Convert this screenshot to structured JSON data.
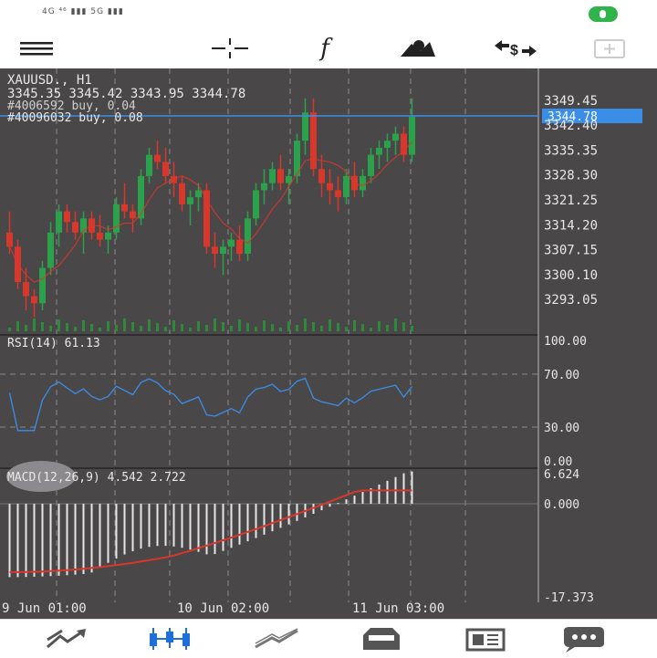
{
  "status": {
    "left_text": "4G ⁴⁶ ▮▮▮ 5G ▮▮▮"
  },
  "toolbar": {
    "items": [
      {
        "name": "menu-icon"
      },
      {
        "name": "crosshair-icon"
      },
      {
        "name": "indicators-icon",
        "label": "f"
      },
      {
        "name": "objects-icon"
      },
      {
        "name": "trade-icon",
        "label": "$"
      },
      {
        "name": "new-order-icon"
      }
    ]
  },
  "chart": {
    "symbol_line": "XAUUSD., H1",
    "ohlc_line": "3345.35 3345.42 3343.95 3344.78",
    "order_line_1": "#4006592 buy, 0.04",
    "order_line_2": "#40096032 buy, 0.08",
    "current_price": "3344.78",
    "price_labels": [
      "3349.45",
      "3342.40",
      "3335.35",
      "3328.30",
      "3321.25",
      "3314.20",
      "3307.15",
      "3300.10",
      "3293.05"
    ],
    "rsi_label": "RSI(14) 61.13",
    "rsi_levels": [
      "100.00",
      "70.00",
      "30.00",
      "0.00"
    ],
    "macd_label": "MACD(12,26,9) 4.542 2.722",
    "macd_levels": [
      "6.624",
      "0.000",
      "-17.373"
    ],
    "time_labels": [
      "9 Jun 01:00",
      "10 Jun 02:00",
      "11 Jun 03:00"
    ],
    "colors": {
      "background": "#4a4749",
      "bull": "#2aa14a",
      "bear": "#d8372b",
      "price_line": "#3a8ee8",
      "rsi": "#3a8ee8",
      "macd_signal": "#d8372b",
      "macd_hist": "#e6e6e6",
      "grid": "#8a8a8a"
    }
  },
  "chart_data": {
    "type": "candlestick",
    "symbol": "XAUUSD.",
    "timeframe": "H1",
    "ylim": [
      3290,
      3352
    ],
    "bid": 3344.78,
    "candles": [
      [
        3312,
        3318,
        3306,
        3308
      ],
      [
        3308,
        3310,
        3296,
        3298
      ],
      [
        3298,
        3302,
        3290,
        3294
      ],
      [
        3294,
        3296,
        3288,
        3292
      ],
      [
        3292,
        3304,
        3290,
        3302
      ],
      [
        3302,
        3315,
        3300,
        3312
      ],
      [
        3312,
        3320,
        3308,
        3318
      ],
      [
        3318,
        3320,
        3312,
        3315
      ],
      [
        3315,
        3318,
        3310,
        3312
      ],
      [
        3312,
        3318,
        3306,
        3316
      ],
      [
        3316,
        3318,
        3310,
        3312
      ],
      [
        3312,
        3317,
        3308,
        3310
      ],
      [
        3310,
        3314,
        3306,
        3312
      ],
      [
        3312,
        3322,
        3310,
        3320
      ],
      [
        3320,
        3326,
        3316,
        3318
      ],
      [
        3318,
        3320,
        3312,
        3316
      ],
      [
        3316,
        3330,
        3314,
        3328
      ],
      [
        3328,
        3336,
        3326,
        3334
      ],
      [
        3334,
        3338,
        3330,
        3332
      ],
      [
        3332,
        3336,
        3326,
        3328
      ],
      [
        3328,
        3332,
        3322,
        3326
      ],
      [
        3326,
        3328,
        3318,
        3320
      ],
      [
        3320,
        3324,
        3314,
        3322
      ],
      [
        3322,
        3326,
        3318,
        3324
      ],
      [
        3324,
        3326,
        3306,
        3308
      ],
      [
        3308,
        3312,
        3302,
        3306
      ],
      [
        3306,
        3310,
        3300,
        3308
      ],
      [
        3308,
        3312,
        3304,
        3310
      ],
      [
        3310,
        3314,
        3304,
        3306
      ],
      [
        3306,
        3318,
        3304,
        3316
      ],
      [
        3316,
        3326,
        3314,
        3324
      ],
      [
        3324,
        3330,
        3320,
        3326
      ],
      [
        3326,
        3332,
        3324,
        3330
      ],
      [
        3330,
        3334,
        3324,
        3326
      ],
      [
        3326,
        3330,
        3320,
        3328
      ],
      [
        3328,
        3340,
        3326,
        3338
      ],
      [
        3338,
        3350,
        3334,
        3346
      ],
      [
        3346,
        3350,
        3328,
        3330
      ],
      [
        3330,
        3334,
        3322,
        3326
      ],
      [
        3326,
        3330,
        3320,
        3324
      ],
      [
        3324,
        3328,
        3318,
        3322
      ],
      [
        3322,
        3330,
        3320,
        3328
      ],
      [
        3328,
        3332,
        3322,
        3324
      ],
      [
        3324,
        3330,
        3322,
        3328
      ],
      [
        3328,
        3336,
        3326,
        3334
      ],
      [
        3334,
        3338,
        3330,
        3336
      ],
      [
        3336,
        3340,
        3332,
        3338
      ],
      [
        3338,
        3342,
        3334,
        3340
      ],
      [
        3340,
        3342,
        3332,
        3334
      ],
      [
        3334,
        3350,
        3332,
        3344.78
      ]
    ],
    "rsi": {
      "period": 14,
      "value": 61.13,
      "levels": [
        70,
        30
      ]
    },
    "macd": {
      "params": [
        12,
        26,
        9
      ],
      "main": 4.542,
      "signal": 2.722,
      "range": [
        -17.373,
        6.624
      ]
    },
    "x_ticks": [
      "9 Jun 01:00",
      "10 Jun 02:00",
      "11 Jun 03:00"
    ]
  },
  "bottom_nav": [
    {
      "name": "quotes-icon"
    },
    {
      "name": "chart-icon",
      "active": true
    },
    {
      "name": "trade-icon"
    },
    {
      "name": "history-icon"
    },
    {
      "name": "news-icon"
    },
    {
      "name": "messages-icon"
    }
  ]
}
